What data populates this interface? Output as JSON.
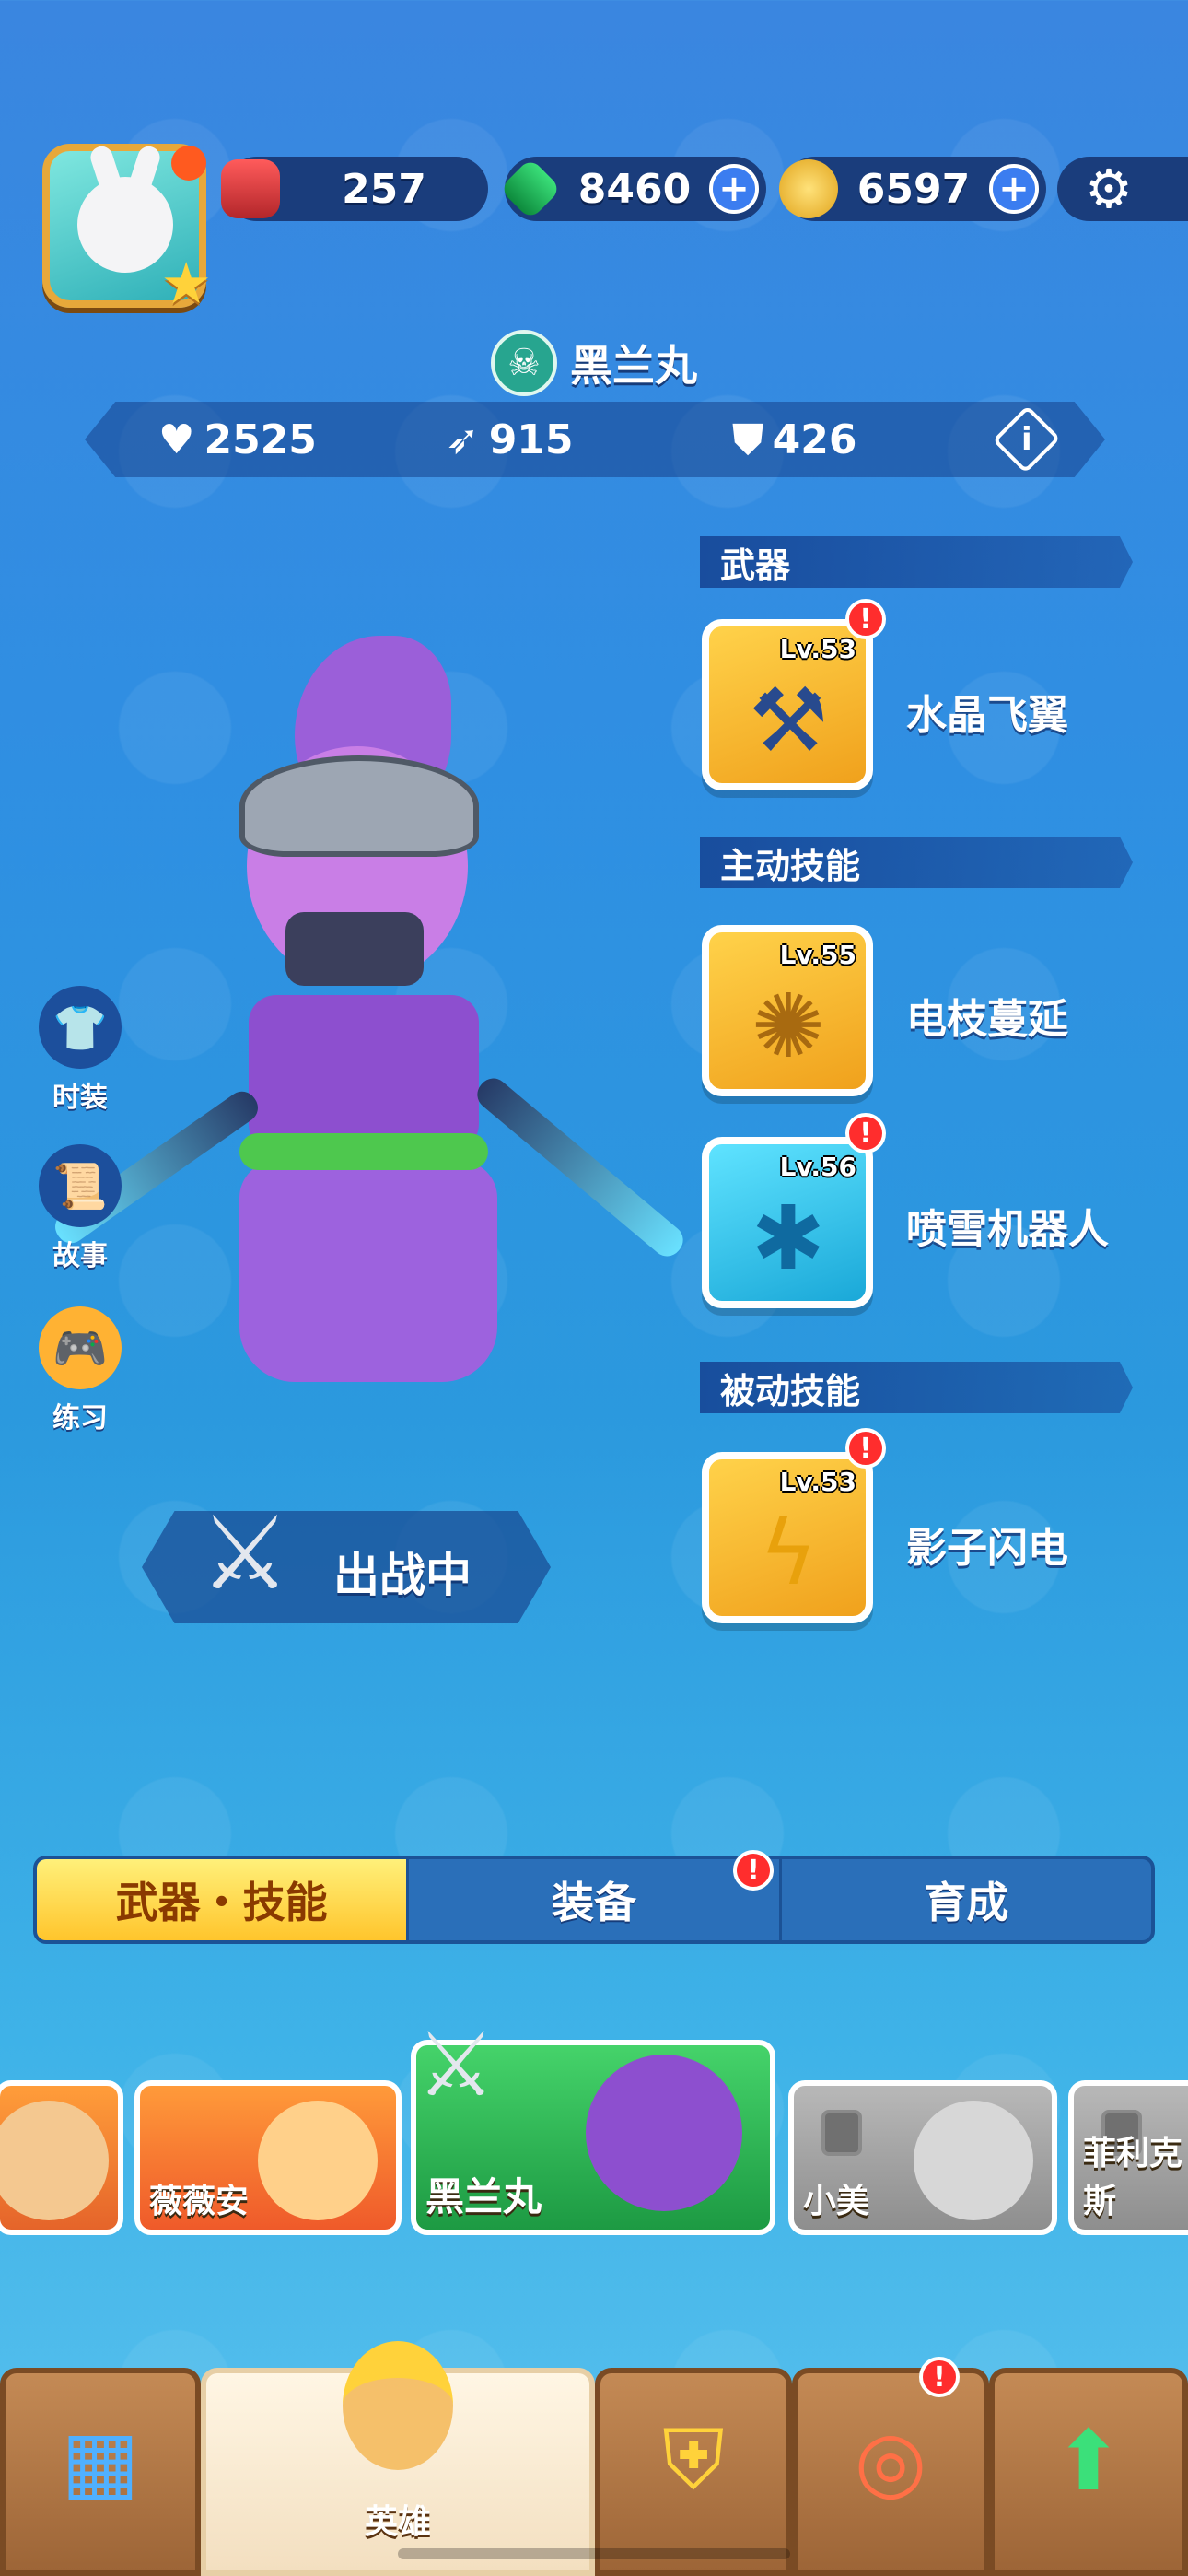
{
  "top_bar": {
    "trophies": "257",
    "gems": "8460",
    "coins": "6597"
  },
  "hero": {
    "name": "黑兰丸",
    "stats": {
      "health": "2525",
      "attack": "915",
      "defense": "426"
    }
  },
  "sections": {
    "weapon": "武器",
    "active": "主动技能",
    "passive": "被动技能"
  },
  "skills": [
    {
      "level": "Lv.53",
      "name": "水晶飞翼",
      "alert": "!"
    },
    {
      "level": "Lv.55",
      "name": "电枝蔓延",
      "alert": ""
    },
    {
      "level": "Lv.56",
      "name": "喷雪机器人",
      "alert": "!"
    },
    {
      "level": "Lv.53",
      "name": "影子闪电",
      "alert": "!"
    }
  ],
  "side_buttons": [
    {
      "label": "时装"
    },
    {
      "label": "故事"
    },
    {
      "label": "练习"
    }
  ],
  "battle_status": "出战中",
  "tabs": [
    {
      "label": "武器・技能",
      "active": true
    },
    {
      "label": "装备",
      "alert": "!"
    },
    {
      "label": "育成"
    }
  ],
  "hero_roster": [
    {
      "name": ""
    },
    {
      "name": "薇薇安"
    },
    {
      "name": "黑兰丸"
    },
    {
      "name": "小美"
    },
    {
      "name": "菲利克斯"
    }
  ],
  "bottom_nav": [
    {
      "label": ""
    },
    {
      "label": "英雄"
    },
    {
      "label": ""
    },
    {
      "label": "",
      "alert": "!"
    },
    {
      "label": ""
    }
  ],
  "colors": {
    "accent": "#ffc52c",
    "alert": "#ff2d2d",
    "panel": "#1a3d7c"
  }
}
